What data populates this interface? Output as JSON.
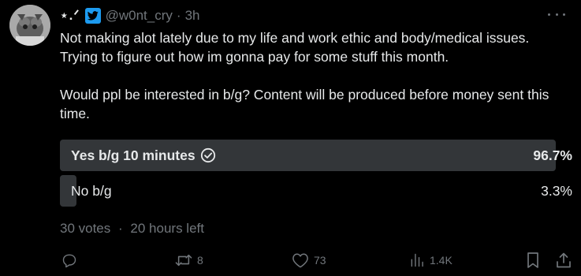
{
  "author": {
    "display_name": "⋆.ᐟ",
    "handle": "@w0nt_cry",
    "separator": "·",
    "time": "3h"
  },
  "tweet": {
    "paragraph_1": "Not making alot lately due to my life and work ethic and body/medical issues. Trying to figure out how im gonna pay for some stuff this month.",
    "paragraph_2": "Would ppl be interested in b/g? Content will be produced before money sent this time."
  },
  "poll": {
    "options": [
      {
        "label": "Yes b/g 10 minutes",
        "percent_text": "96.7%",
        "percent": 96.7,
        "winner": true
      },
      {
        "label": "No b/g",
        "percent_text": "3.3%",
        "percent": 3.3,
        "winner": false
      }
    ],
    "votes": "30 votes",
    "separator": "·",
    "time_left": "20 hours left"
  },
  "actions": {
    "reply_count": "",
    "retweet_count": "8",
    "like_count": "73",
    "views_count": "1.4K"
  },
  "icons": {
    "avatar": "avatar-image",
    "badge": "bird-badge-icon",
    "more": "more-icon",
    "check": "check-circle-icon",
    "reply": "reply-icon",
    "retweet": "retweet-icon",
    "like": "heart-icon",
    "views": "views-icon",
    "bookmark": "bookmark-icon",
    "share": "share-icon"
  },
  "colors": {
    "background": "#000000",
    "text": "#e7e9ea",
    "muted": "#71767b",
    "poll_fill": "#333639",
    "accent": "#1d9bf0"
  }
}
